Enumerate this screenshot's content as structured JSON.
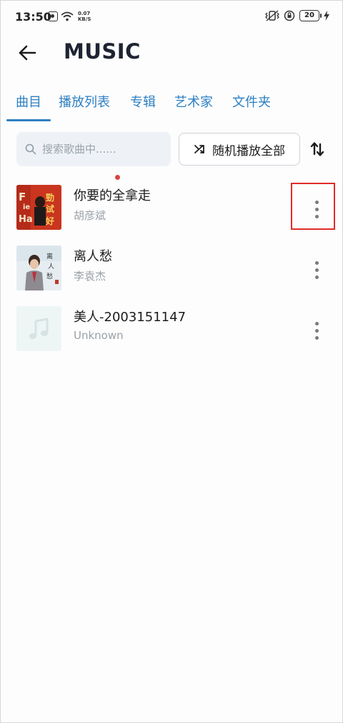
{
  "status_bar": {
    "time": "13:50",
    "net_speed_value": "0.07",
    "net_speed_unit": "KB/S",
    "battery": "20"
  },
  "header": {
    "title": "MUSIC",
    "back_icon": "arrow-left-icon"
  },
  "tabs": [
    {
      "label": "曲目",
      "active": true
    },
    {
      "label": "播放列表",
      "active": false,
      "badge": "dot"
    },
    {
      "label": "专辑",
      "active": false
    },
    {
      "label": "艺术家",
      "active": false
    },
    {
      "label": "文件夹",
      "active": false
    }
  ],
  "search": {
    "placeholder": "搜索歌曲中......",
    "icon": "search-icon"
  },
  "shuffle": {
    "label": "随机播放全部",
    "icon": "shuffle-icon"
  },
  "sort": {
    "icon": "sort-arrows-icon"
  },
  "songs": [
    {
      "title": "你要的全拿走",
      "artist": "胡彦斌",
      "cover": "album-cover-1",
      "highlighted": true
    },
    {
      "title": "离人愁",
      "artist": "李袁杰",
      "cover": "album-cover-2",
      "highlighted": false
    },
    {
      "title": "美人-2003151147",
      "artist": "Unknown",
      "cover": "music-note-placeholder",
      "highlighted": false
    }
  ],
  "colors": {
    "accent": "#2d7fc1",
    "badge": "#e0433f",
    "highlight_box": "#e02b2b",
    "title": "#1f2433"
  }
}
